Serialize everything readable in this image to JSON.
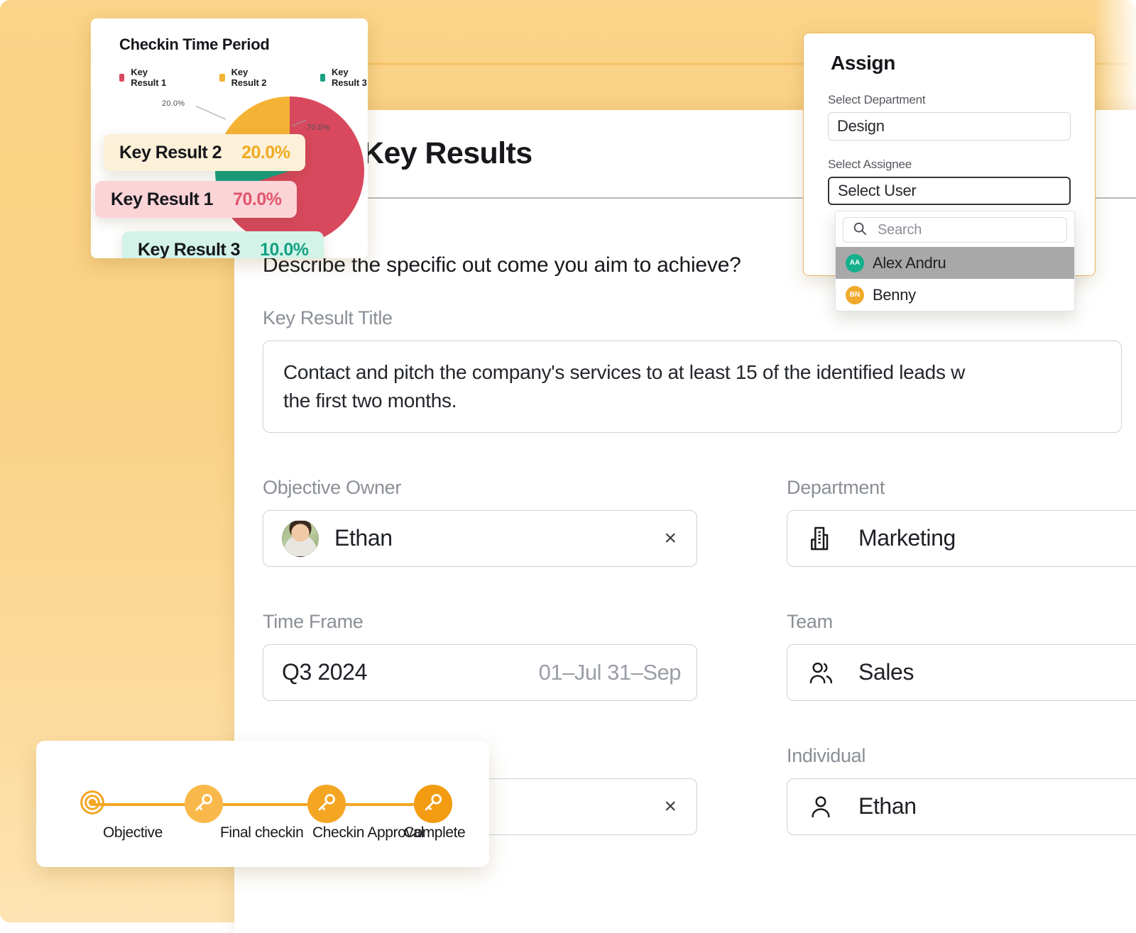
{
  "background": {
    "gradient_from": "#fbd489",
    "gradient_to": "#fde4b3"
  },
  "app": {
    "title": "Key Results",
    "question": "Describe the specific out come you aim to achieve?",
    "fields": {
      "key_result_title": {
        "label": "Key Result Title",
        "value_line1": "Contact and pitch the company's services to at least 15 of the identified leads w",
        "value_line2": "the first two months."
      },
      "objective_owner": {
        "label": "Objective Owner",
        "value": "Ethan",
        "clear": "×",
        "icon": "avatar-photo"
      },
      "department": {
        "label": "Department",
        "value": "Marketing",
        "icon": "building-icon"
      },
      "time_frame": {
        "label": "Time Frame",
        "value": "Q3 2024",
        "range": "01–Jul 31–Sep"
      },
      "team": {
        "label": "Team",
        "value": "Sales",
        "icon": "users-icon"
      },
      "individual": {
        "label": "Individual",
        "value": "Ethan",
        "icon": "user-icon"
      },
      "hidden_field": {
        "clear": "×"
      }
    }
  },
  "chart_card": {
    "title": "Checkin Time Period",
    "tooltips": [
      {
        "name": "Key Result 2",
        "value": "20.0%",
        "bg": "#fdf0d8",
        "fg": "#efab22"
      },
      {
        "name": "Key Result 1",
        "value": "70.0%",
        "bg": "#fbd4d8",
        "fg": "#e2566b"
      },
      {
        "name": "Key Result 3",
        "value": "10.0%",
        "bg": "#d3f3e8",
        "fg": "#14a184"
      }
    ]
  },
  "chart_data": {
    "type": "pie",
    "title": "Checkin Time Period",
    "categories": [
      "Key Result 1",
      "Key Result 2",
      "Key Result 3"
    ],
    "values": [
      70.0,
      20.0,
      10.0
    ],
    "labels": [
      "70.0%",
      "20.0%",
      "10.0%"
    ],
    "colors": [
      "#d9495e",
      "#f5b335",
      "#16a181"
    ],
    "legend": [
      "Key Result 1",
      "Key Result 2",
      "Key Result 3"
    ],
    "legend_position": "top",
    "xlabel": "",
    "ylabel": "",
    "grid": false
  },
  "assign": {
    "title": "Assign",
    "department_label": "Select Department",
    "department_value": "Design",
    "assignee_label": "Select Assignee",
    "assignee_value": "Select User",
    "search_placeholder": "Search",
    "users": [
      {
        "initials": "AA",
        "name": "Alex Andru",
        "color": "#14b18c",
        "selected": true
      },
      {
        "initials": "BN",
        "name": "Benny",
        "color": "#f0a92c",
        "selected": false
      }
    ]
  },
  "stepper": {
    "steps": [
      {
        "label": "Objective",
        "icon": "target-icon"
      },
      {
        "label": "Final checkin",
        "icon": "key-icon"
      },
      {
        "label": "Checkin Approval",
        "icon": "key-icon"
      },
      {
        "label": "Complete",
        "icon": "key-icon"
      }
    ],
    "accent": "#f4a623"
  }
}
